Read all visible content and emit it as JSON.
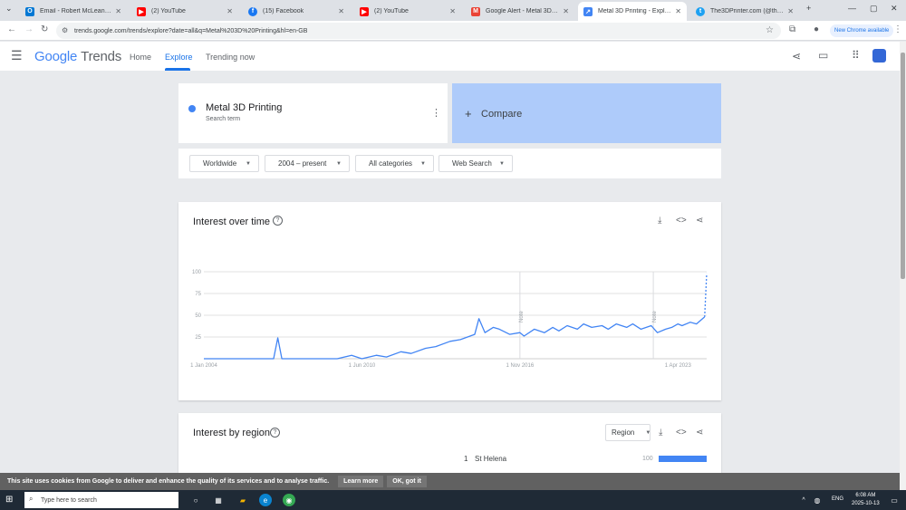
{
  "browser": {
    "tabs": [
      {
        "label": "Email - Robert McLean - Outlo",
        "icon": "outlook-icon",
        "color": "#0078d4"
      },
      {
        "label": "(2) YouTube",
        "icon": "youtube-icon",
        "color": "#ff0000"
      },
      {
        "label": "(15) Facebook",
        "icon": "facebook-icon",
        "color": "#1877f2"
      },
      {
        "label": "(2) YouTube",
        "icon": "youtube-icon",
        "color": "#ff0000"
      },
      {
        "label": "Google Alert - Metal 3D Printi",
        "icon": "gmail-icon",
        "color": "#ea4335"
      },
      {
        "label": "Metal 3D Printing - Explore - G",
        "icon": "trends-icon",
        "color": "#4285f4"
      },
      {
        "label": "The3DPrinter.com (@the3dpri",
        "icon": "twitter-icon",
        "color": "#1da1f2"
      }
    ],
    "url": "trends.google.com/trends/explore?date=all&q=Metal%203D%20Printing&hl=en-GB",
    "update_label": "New Chrome available"
  },
  "header": {
    "logo_google": "Google",
    "logo_trends": "Trends",
    "nav": [
      {
        "label": "Home"
      },
      {
        "label": "Explore"
      },
      {
        "label": "Trending now"
      }
    ]
  },
  "search": {
    "term": "Metal 3D Printing",
    "term_type": "Search term",
    "compare_label": "Compare"
  },
  "filters": {
    "location": "Worldwide",
    "time": "2004 – present",
    "category": "All categories",
    "property": "Web Search"
  },
  "interest_over_time": {
    "title": "Interest over time",
    "note_label": "Note",
    "chart_data": {
      "type": "line",
      "title": "Interest over time",
      "xlabel": "",
      "ylabel": "",
      "ylim": [
        0,
        100
      ],
      "y_ticks": [
        100,
        75,
        50,
        25
      ],
      "x_ticks": [
        "1 Jan 2004",
        "1 Jun 2010",
        "1 Nov 2016",
        "1 Apr 2023"
      ],
      "notes_at": [
        "2016-11",
        "2022-04"
      ],
      "series": [
        {
          "color": "#4285f4",
          "points": [
            [
              "2004-01",
              0
            ],
            [
              "2005-06",
              0
            ],
            [
              "2006-01",
              0
            ],
            [
              "2006-11",
              0
            ],
            [
              "2007-01",
              24
            ],
            [
              "2007-03",
              0
            ],
            [
              "2008-06",
              0
            ],
            [
              "2009-06",
              0
            ],
            [
              "2010-01",
              4
            ],
            [
              "2010-06",
              0
            ],
            [
              "2011-01",
              4
            ],
            [
              "2011-06",
              2
            ],
            [
              "2012-01",
              8
            ],
            [
              "2012-06",
              6
            ],
            [
              "2013-01",
              12
            ],
            [
              "2013-06",
              14
            ],
            [
              "2014-01",
              20
            ],
            [
              "2014-06",
              22
            ],
            [
              "2015-01",
              28
            ],
            [
              "2015-03",
              46
            ],
            [
              "2015-06",
              30
            ],
            [
              "2015-10",
              36
            ],
            [
              "2016-01",
              34
            ],
            [
              "2016-06",
              28
            ],
            [
              "2016-11",
              30
            ],
            [
              "2017-01",
              26
            ],
            [
              "2017-06",
              34
            ],
            [
              "2017-11",
              30
            ],
            [
              "2018-03",
              36
            ],
            [
              "2018-06",
              32
            ],
            [
              "2018-10",
              38
            ],
            [
              "2019-03",
              34
            ],
            [
              "2019-06",
              40
            ],
            [
              "2019-10",
              36
            ],
            [
              "2020-03",
              38
            ],
            [
              "2020-06",
              34
            ],
            [
              "2020-10",
              40
            ],
            [
              "2021-03",
              36
            ],
            [
              "2021-06",
              40
            ],
            [
              "2021-10",
              34
            ],
            [
              "2022-03",
              38
            ],
            [
              "2022-06",
              30
            ],
            [
              "2022-10",
              34
            ],
            [
              "2023-01",
              36
            ],
            [
              "2023-04",
              40
            ],
            [
              "2023-06",
              38
            ],
            [
              "2023-10",
              42
            ],
            [
              "2024-01",
              40
            ],
            [
              "2024-04",
              46
            ],
            [
              "2024-05",
              48
            ],
            [
              "2024-06",
              98
            ]
          ]
        }
      ]
    }
  },
  "interest_by_region": {
    "title": "Interest by region",
    "select_label": "Region",
    "rows": [
      {
        "rank": "1",
        "name": "St Helena",
        "value": "100",
        "fraction": 1.0
      }
    ]
  },
  "cookie_bar": {
    "text": "This site uses cookies from Google to deliver and enhance the quality of its services and to analyse traffic.",
    "learn_more": "Learn more",
    "ok": "OK, got it"
  },
  "taskbar": {
    "search_placeholder": "Type here to search",
    "lang": "ENG",
    "time": "6:08 AM",
    "date": "2025-10-13"
  }
}
